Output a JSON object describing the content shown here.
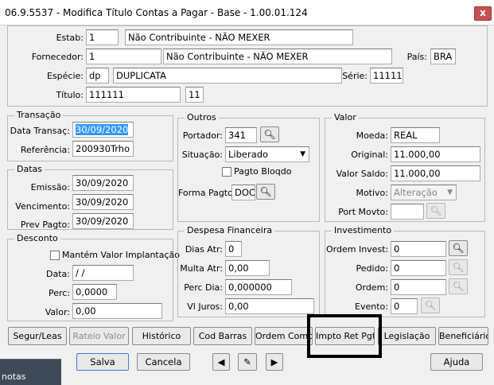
{
  "window": {
    "title": "06.9.5537 - Modifica Título Contas a Pagar - Base - 1.00.01.124",
    "close": "x"
  },
  "header": {
    "estab_label": "Estab:",
    "estab_code": "1",
    "estab_name": "Não Contribuinte - NÃO MEXER",
    "fornecedor_label": "Fornecedor:",
    "fornecedor_code": "1",
    "fornecedor_name": "Não Contribuinte - NÃO MEXER",
    "pais_label": "País:",
    "pais_value": "BRA",
    "especie_label": "Espécie:",
    "especie_code": "dp",
    "especie_name": "DUPLICATA",
    "serie_label": "Série:",
    "serie_value": "11111",
    "titulo_label": "Título:",
    "titulo_value": "111111",
    "parcela_value": "11"
  },
  "transacao": {
    "legend": "Transação",
    "data_label": "Data Transaç:",
    "data_value": "30/09/2020",
    "ref_label": "Referência:",
    "ref_value": "200930Trho"
  },
  "datas": {
    "legend": "Datas",
    "emissao_label": "Emissão:",
    "emissao_value": "30/09/2020",
    "venc_label": "Vencimento:",
    "venc_value": "30/09/2020",
    "prev_label": "Prev Pagto:",
    "prev_value": "30/09/2020"
  },
  "desconto": {
    "legend": "Desconto",
    "mantem_label": "Mantém Valor Implantação",
    "data_label": "Data:",
    "data_value": "/ /",
    "perc_label": "Perc:",
    "perc_value": "0,0000",
    "valor_label": "Valor:",
    "valor_value": "0,00"
  },
  "outros": {
    "legend": "Outros",
    "portador_label": "Portador:",
    "portador_value": "341",
    "situacao_label": "Situação:",
    "situacao_value": "Liberado",
    "bloq_label": "Pagto Bloqdo",
    "forma_label": "Forma Pagto:",
    "forma_value": "DOC"
  },
  "despesa": {
    "legend": "Despesa Financeira",
    "dias_label": "Dias Atr:",
    "dias_value": "0",
    "multa_label": "Multa Atr:",
    "multa_value": "0,00",
    "perc_label": "Perc Dia:",
    "perc_value": "0,000000",
    "juros_label": "Vl Juros:",
    "juros_value": "0,00"
  },
  "valor": {
    "legend": "Valor",
    "moeda_label": "Moeda:",
    "moeda_value": "REAL",
    "original_label": "Original:",
    "original_value": "11.000,00",
    "saldo_label": "Valor Saldo:",
    "saldo_value": "11.000,00",
    "motivo_label": "Motivo:",
    "motivo_value": "Alteração",
    "port_label": "Port Movto:",
    "port_value": ""
  },
  "investimento": {
    "legend": "Investimento",
    "ordem_label": "Ordem Invest:",
    "ordem_value": "0",
    "pedido_label": "Pedido:",
    "pedido_value": "0",
    "ordem2_label": "Ordem:",
    "ordem2_value": "0",
    "evento_label": "Evento:",
    "evento_value": "0"
  },
  "tabs": [
    "Segur/Leas",
    "Rateio Valor",
    "Histórico",
    "Cod Barras",
    "Ordem Compr",
    "Impto Ret Pgto",
    "Legislação",
    "Beneficiário"
  ],
  "buttons": {
    "salva": "Salva",
    "cancela": "Cancela",
    "ajuda": "Ajuda"
  },
  "taskbar": {
    "label": "notas"
  }
}
